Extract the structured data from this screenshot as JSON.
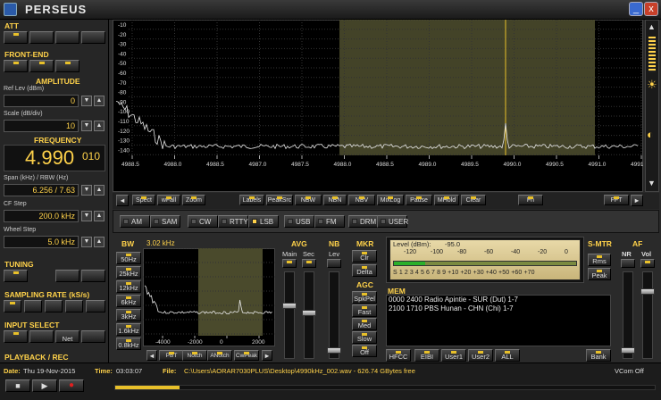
{
  "window": {
    "title": "PERSEUS",
    "minimize": "_",
    "close": "x"
  },
  "left": {
    "att": {
      "title": "ATT"
    },
    "front_end": {
      "title": "FRONT-END"
    },
    "amplitude": {
      "title": "AMPLITUDE",
      "ref_label": "Ref Lev (dBm)",
      "ref_value": "0",
      "scale_label": "Scale (dB/div)",
      "scale_value": "10"
    },
    "frequency": {
      "title": "FREQUENCY",
      "main": "4.990",
      "sub": "010",
      "span_label": "Span (kHz) / RBW (Hz)",
      "span_value": "6.256 / 7.63",
      "cf_label": "CF Step",
      "cf_value": "200.0 kHz",
      "wheel_label": "Wheel Step",
      "wheel_value": "5.0 kHz"
    },
    "tuning": {
      "title": "TUNING"
    },
    "sampling": {
      "title": "SAMPLING RATE (kS/s)"
    },
    "input": {
      "title": "INPUT SELECT",
      "net": "Net"
    },
    "playback": {
      "title": "PLAYBACK / REC"
    }
  },
  "spectrum": {
    "y_ticks": [
      "-10",
      "-20",
      "-30",
      "-40",
      "-50",
      "-60",
      "-70",
      "-80",
      "-90",
      "-100",
      "-110",
      "-120",
      "-130",
      "-140"
    ],
    "x_ticks": [
      "4988.5",
      "4988.0",
      "4988.5",
      "4987.0",
      "4987.5",
      "4988.0",
      "4988.5",
      "4989.0",
      "4989.5",
      "4990.0",
      "4990.5",
      "4991.0",
      "4991.5"
    ]
  },
  "toolbar": [
    "Spect",
    "wFall",
    "Zoom",
    "Labels",
    "PeakSrc",
    "NBW",
    "NBN",
    "NBV",
    "MixLog",
    "Pause",
    "MHold",
    "Clear",
    "Fn",
    "FFT"
  ],
  "demod": [
    {
      "label": "AM",
      "on": false
    },
    {
      "label": "SAM",
      "on": false
    },
    {
      "label": "CW",
      "on": false
    },
    {
      "label": "RTTY",
      "on": false
    },
    {
      "label": "LSB",
      "on": true
    },
    {
      "label": "USB",
      "on": false
    },
    {
      "label": "FM",
      "on": false
    },
    {
      "label": "DRM",
      "on": false
    },
    {
      "label": "USER",
      "on": false
    }
  ],
  "bw": {
    "title": "BW",
    "value": "3.02 kHz",
    "options": [
      "50Hz",
      "25kHz",
      "12kHz",
      "6kHz",
      "3kHz",
      "1.6kHz",
      "0.8kHz"
    ],
    "x_ticks": [
      "-4000",
      "-2000",
      "0",
      "2000"
    ],
    "buttons": [
      "PBT",
      "Notch",
      "ANotch",
      "CwPeak"
    ]
  },
  "avg": {
    "title": "AVG",
    "main": "Main",
    "sec": "Sec"
  },
  "nb": {
    "title": "NB",
    "lev": "Lev"
  },
  "mkr": {
    "title": "MKR",
    "buttons": [
      "Clr",
      "Delta"
    ]
  },
  "agc": {
    "title": "AGC",
    "buttons": [
      "SpkPel",
      "Fast",
      "Med",
      "Slow",
      "Off"
    ]
  },
  "level": {
    "label": "Level (dBm):",
    "value": "-95.0",
    "scale_top": [
      "-120",
      "-100",
      "-80",
      "-60",
      "-40",
      "-20",
      "0"
    ],
    "scale_bottom": "S 1 2 3 4 5 6 7 8 9 +10 +20 +30 +40 +50 +60 +70",
    "fill": 0.17
  },
  "smtr": {
    "title": "S-MTR",
    "buttons": [
      "Rms",
      "Peak"
    ]
  },
  "af": {
    "title": "AF",
    "nr": "NR",
    "vol": "Vol"
  },
  "mem": {
    "title": "MEM",
    "lines": [
      "0000 2400 Radio Apintie - SUR (Dut)   1-7",
      "2100 1710 PBS Hunan - CHN (Chi)   1-7"
    ],
    "buttons": [
      "HFCC",
      "EIBI",
      "User1",
      "User2",
      "ALL",
      "Bank"
    ]
  },
  "status": {
    "date_label": "Date:",
    "date": "Thu 19-Nov-2015",
    "time_label": "Time:",
    "time": "03:03:07",
    "file_label": "File:",
    "file": "C:\\Users\\AORAR7030PLUS\\Desktop\\4990kHz_002.wav - 626.74 GBytes free",
    "vcom": "VCom Off",
    "progress": 0.12
  }
}
